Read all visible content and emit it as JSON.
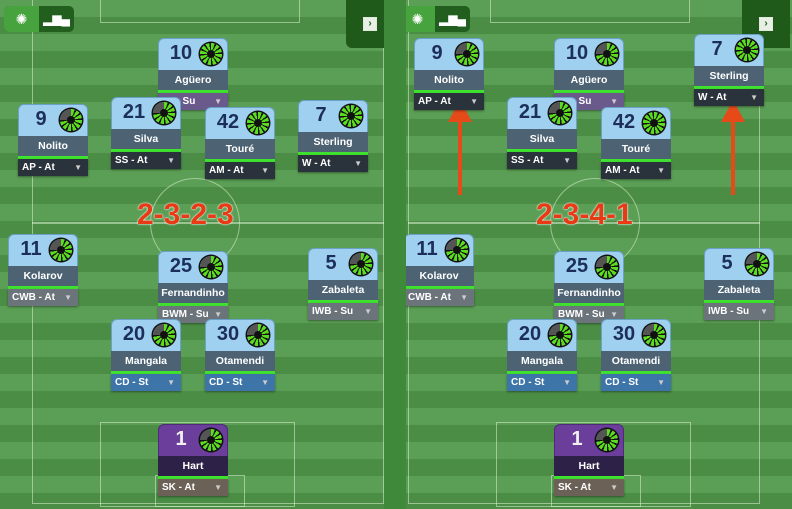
{
  "toggle": {
    "pitch_icon": "pitch-view-icon",
    "stats_icon": "bar-chart-icon"
  },
  "side_tab_icon": "expand-panel-icon",
  "colors": {
    "formation_text": "#e83a14",
    "arrow": "#e64a19",
    "condition_green": "#5bdc1f",
    "card_blue": "#9fd0f0",
    "gk_purple": "#6a3e9a"
  },
  "panels": [
    {
      "formation": "2-3-2-3",
      "players": [
        {
          "number": "10",
          "name": "Agüero",
          "role": "F9 - Su"
        },
        {
          "number": "9",
          "name": "Nolito",
          "role": "AP - At"
        },
        {
          "number": "21",
          "name": "Silva",
          "role": "SS - At"
        },
        {
          "number": "42",
          "name": "Touré",
          "role": "AM - At"
        },
        {
          "number": "7",
          "name": "Sterling",
          "role": "W - At"
        },
        {
          "number": "11",
          "name": "Kolarov",
          "role": "CWB - At"
        },
        {
          "number": "25",
          "name": "Fernandinho",
          "role": "BWM - Su"
        },
        {
          "number": "5",
          "name": "Zabaleta",
          "role": "IWB - Su"
        },
        {
          "number": "20",
          "name": "Mangala",
          "role": "CD - St"
        },
        {
          "number": "30",
          "name": "Otamendi",
          "role": "CD - St"
        },
        {
          "number": "1",
          "name": "Hart",
          "role": "SK - At"
        }
      ]
    },
    {
      "formation": "2-3-4-1",
      "players": [
        {
          "number": "9",
          "name": "Nolito",
          "role": "AP - At"
        },
        {
          "number": "10",
          "name": "Agüero",
          "role": "F9 - Su"
        },
        {
          "number": "7",
          "name": "Sterling",
          "role": "W - At"
        },
        {
          "number": "21",
          "name": "Silva",
          "role": "SS - At"
        },
        {
          "number": "42",
          "name": "Touré",
          "role": "AM - At"
        },
        {
          "number": "11",
          "name": "Kolarov",
          "role": "CWB - At"
        },
        {
          "number": "25",
          "name": "Fernandinho",
          "role": "BWM - Su"
        },
        {
          "number": "5",
          "name": "Zabaleta",
          "role": "IWB - Su"
        },
        {
          "number": "20",
          "name": "Mangala",
          "role": "CD - St"
        },
        {
          "number": "30",
          "name": "Otamendi",
          "role": "CD - St"
        },
        {
          "number": "1",
          "name": "Hart",
          "role": "SK - At"
        }
      ]
    }
  ]
}
